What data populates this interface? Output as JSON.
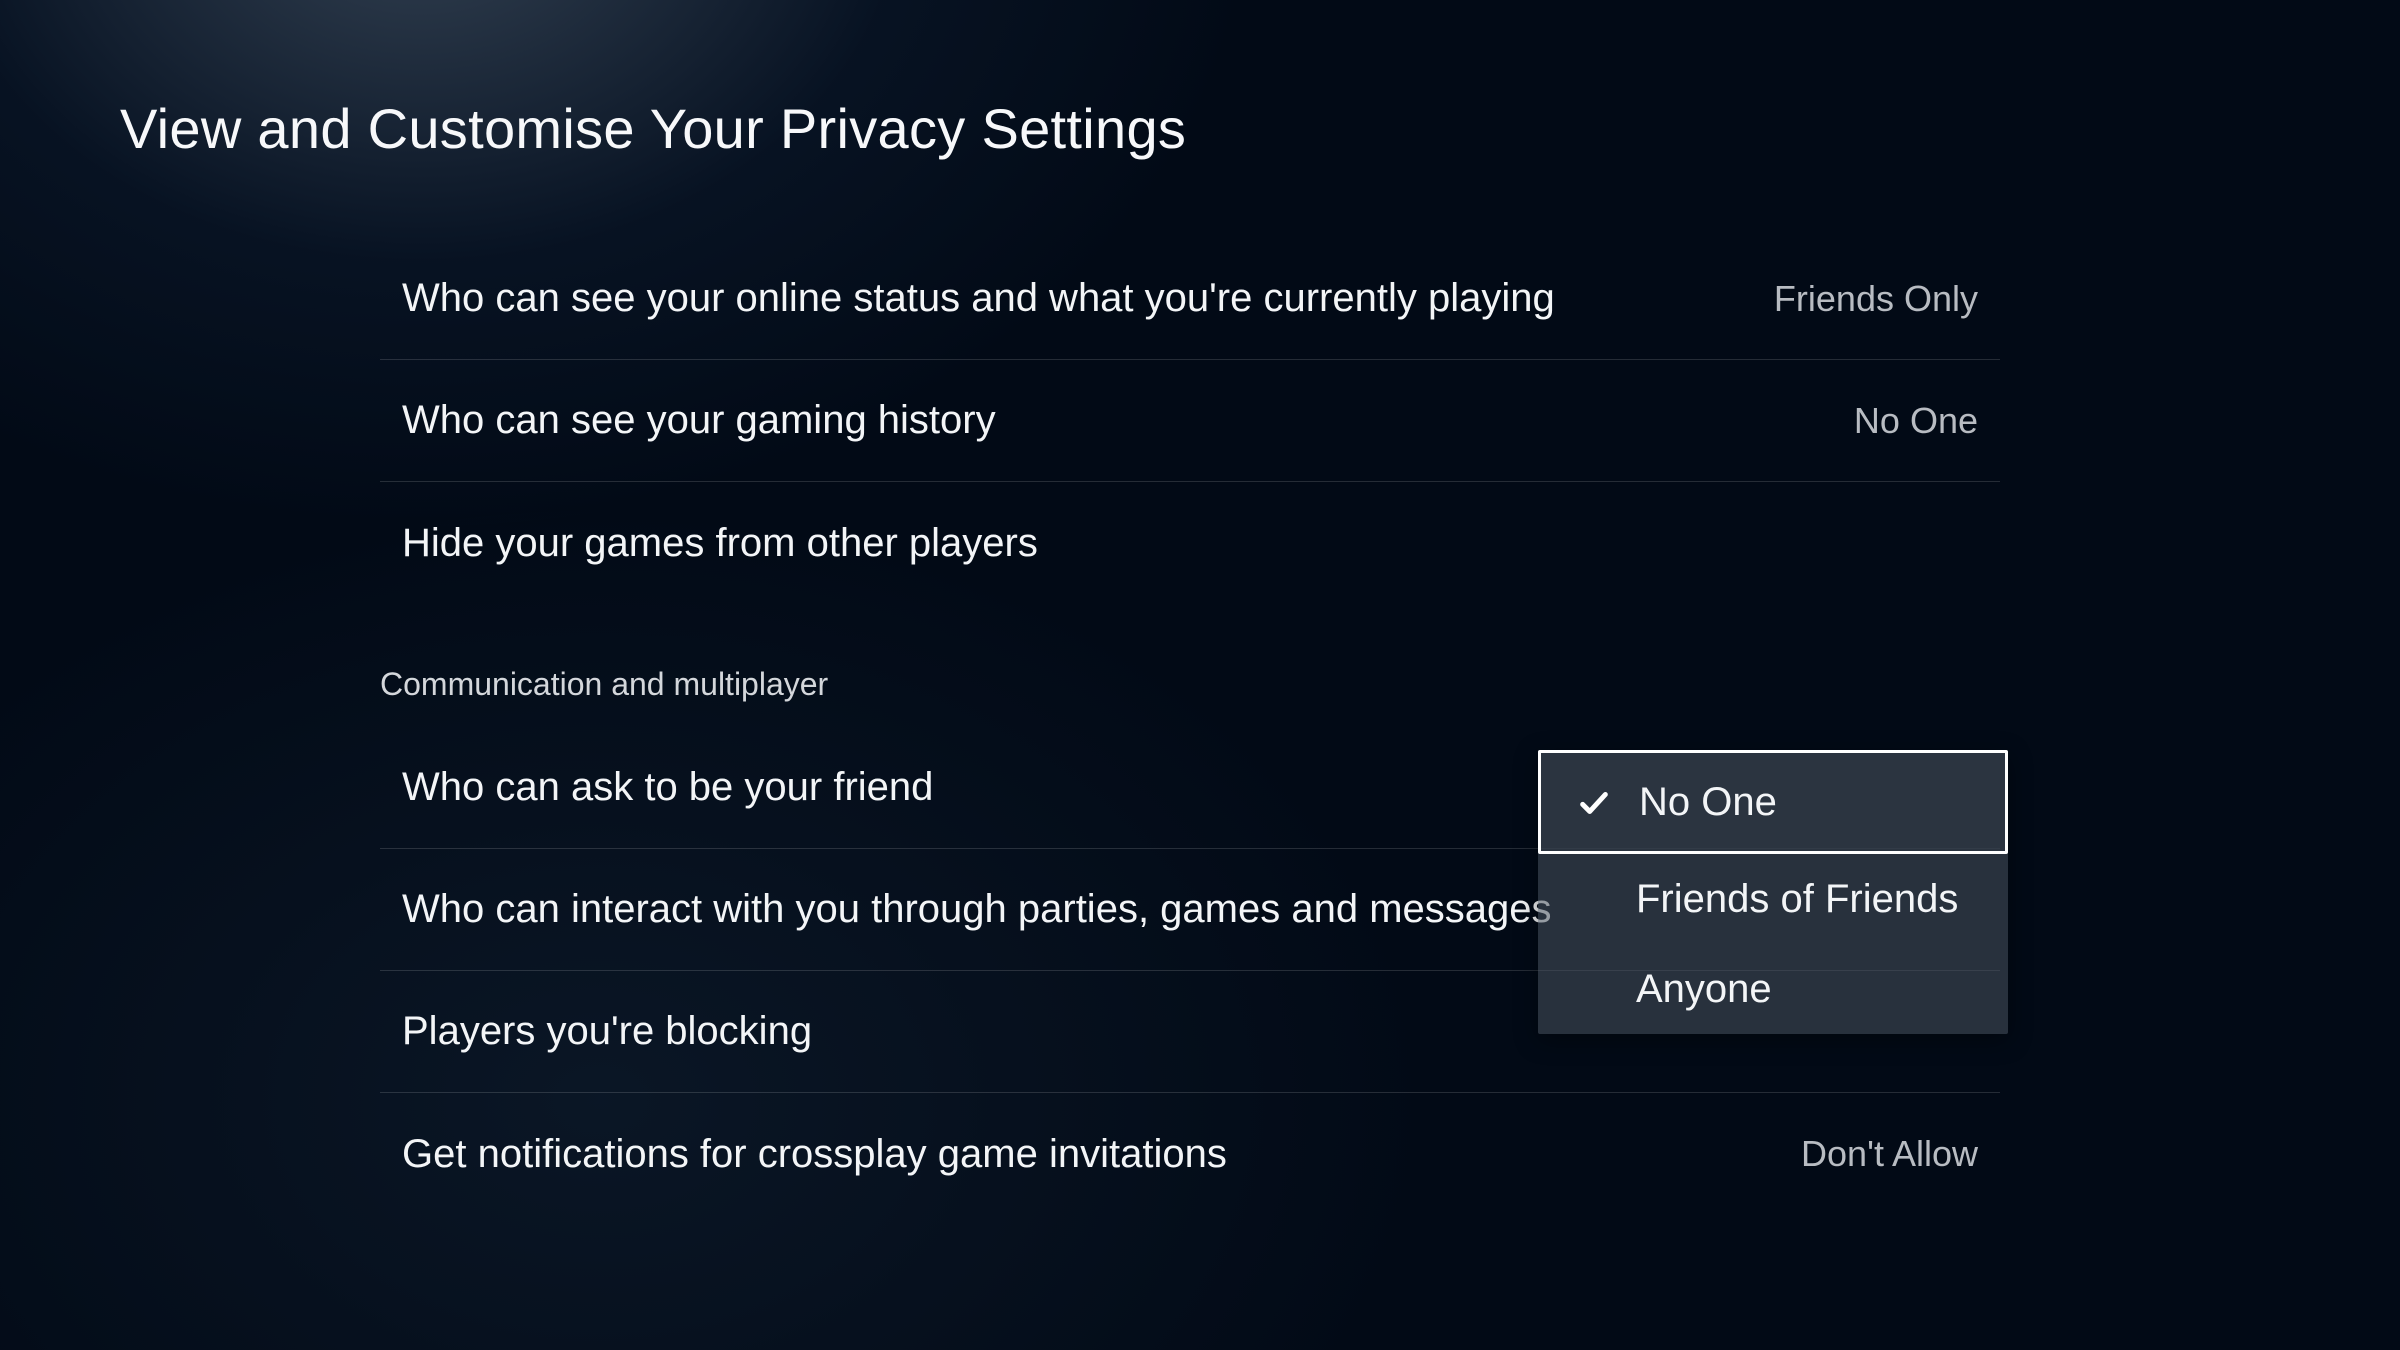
{
  "page_title": "View and Customise Your Privacy Settings",
  "settings_group_1": [
    {
      "label": "Who can see your online status and what you're currently playing",
      "value": "Friends Only"
    },
    {
      "label": "Who can see your gaming history",
      "value": "No One"
    },
    {
      "label": "Hide your games from other players",
      "value": ""
    }
  ],
  "section_header": "Communication and multiplayer",
  "settings_group_2": [
    {
      "label": "Who can ask to be your friend",
      "value": ""
    },
    {
      "label": "Who can interact with you through parties, games and messages",
      "value": ""
    },
    {
      "label": "Players you're blocking",
      "value": ""
    },
    {
      "label": "Get notifications for crossplay game invitations",
      "value": "Don't Allow"
    }
  ],
  "dropdown": {
    "options": [
      "No One",
      "Friends of Friends",
      "Anyone"
    ],
    "selected_index": 0
  }
}
